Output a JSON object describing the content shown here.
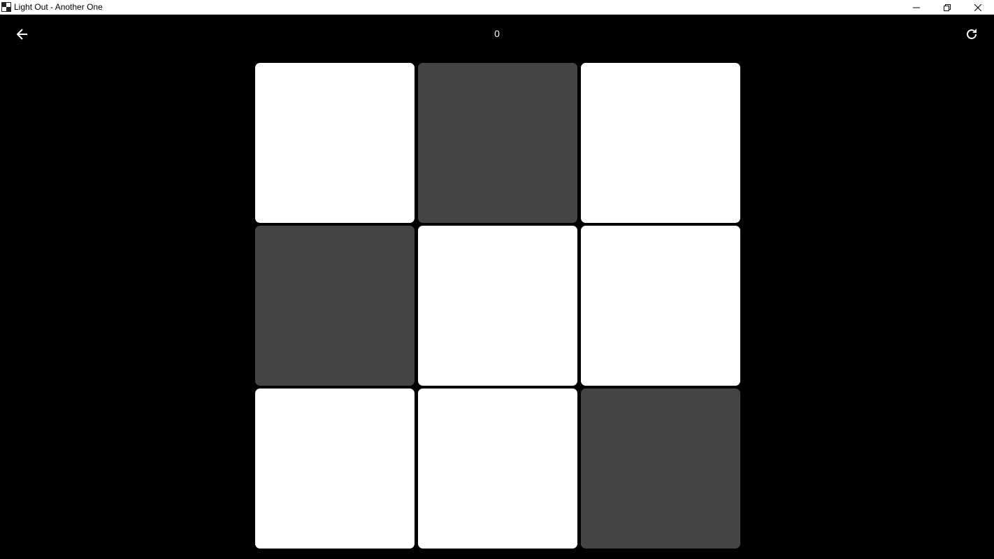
{
  "window": {
    "title": "Light Out - Another One"
  },
  "icons": {
    "back": "arrow-left-icon",
    "refresh": "refresh-icon",
    "minimize": "minimize-icon",
    "maximize": "restore-icon",
    "close": "close-icon"
  },
  "game": {
    "moves": "0",
    "rows": 3,
    "cols": 3,
    "grid": [
      [
        true,
        false,
        true
      ],
      [
        false,
        true,
        true
      ],
      [
        true,
        true,
        false
      ]
    ],
    "colors": {
      "lit": "#ffffff",
      "unlit": "#454346",
      "background": "#000000"
    }
  }
}
